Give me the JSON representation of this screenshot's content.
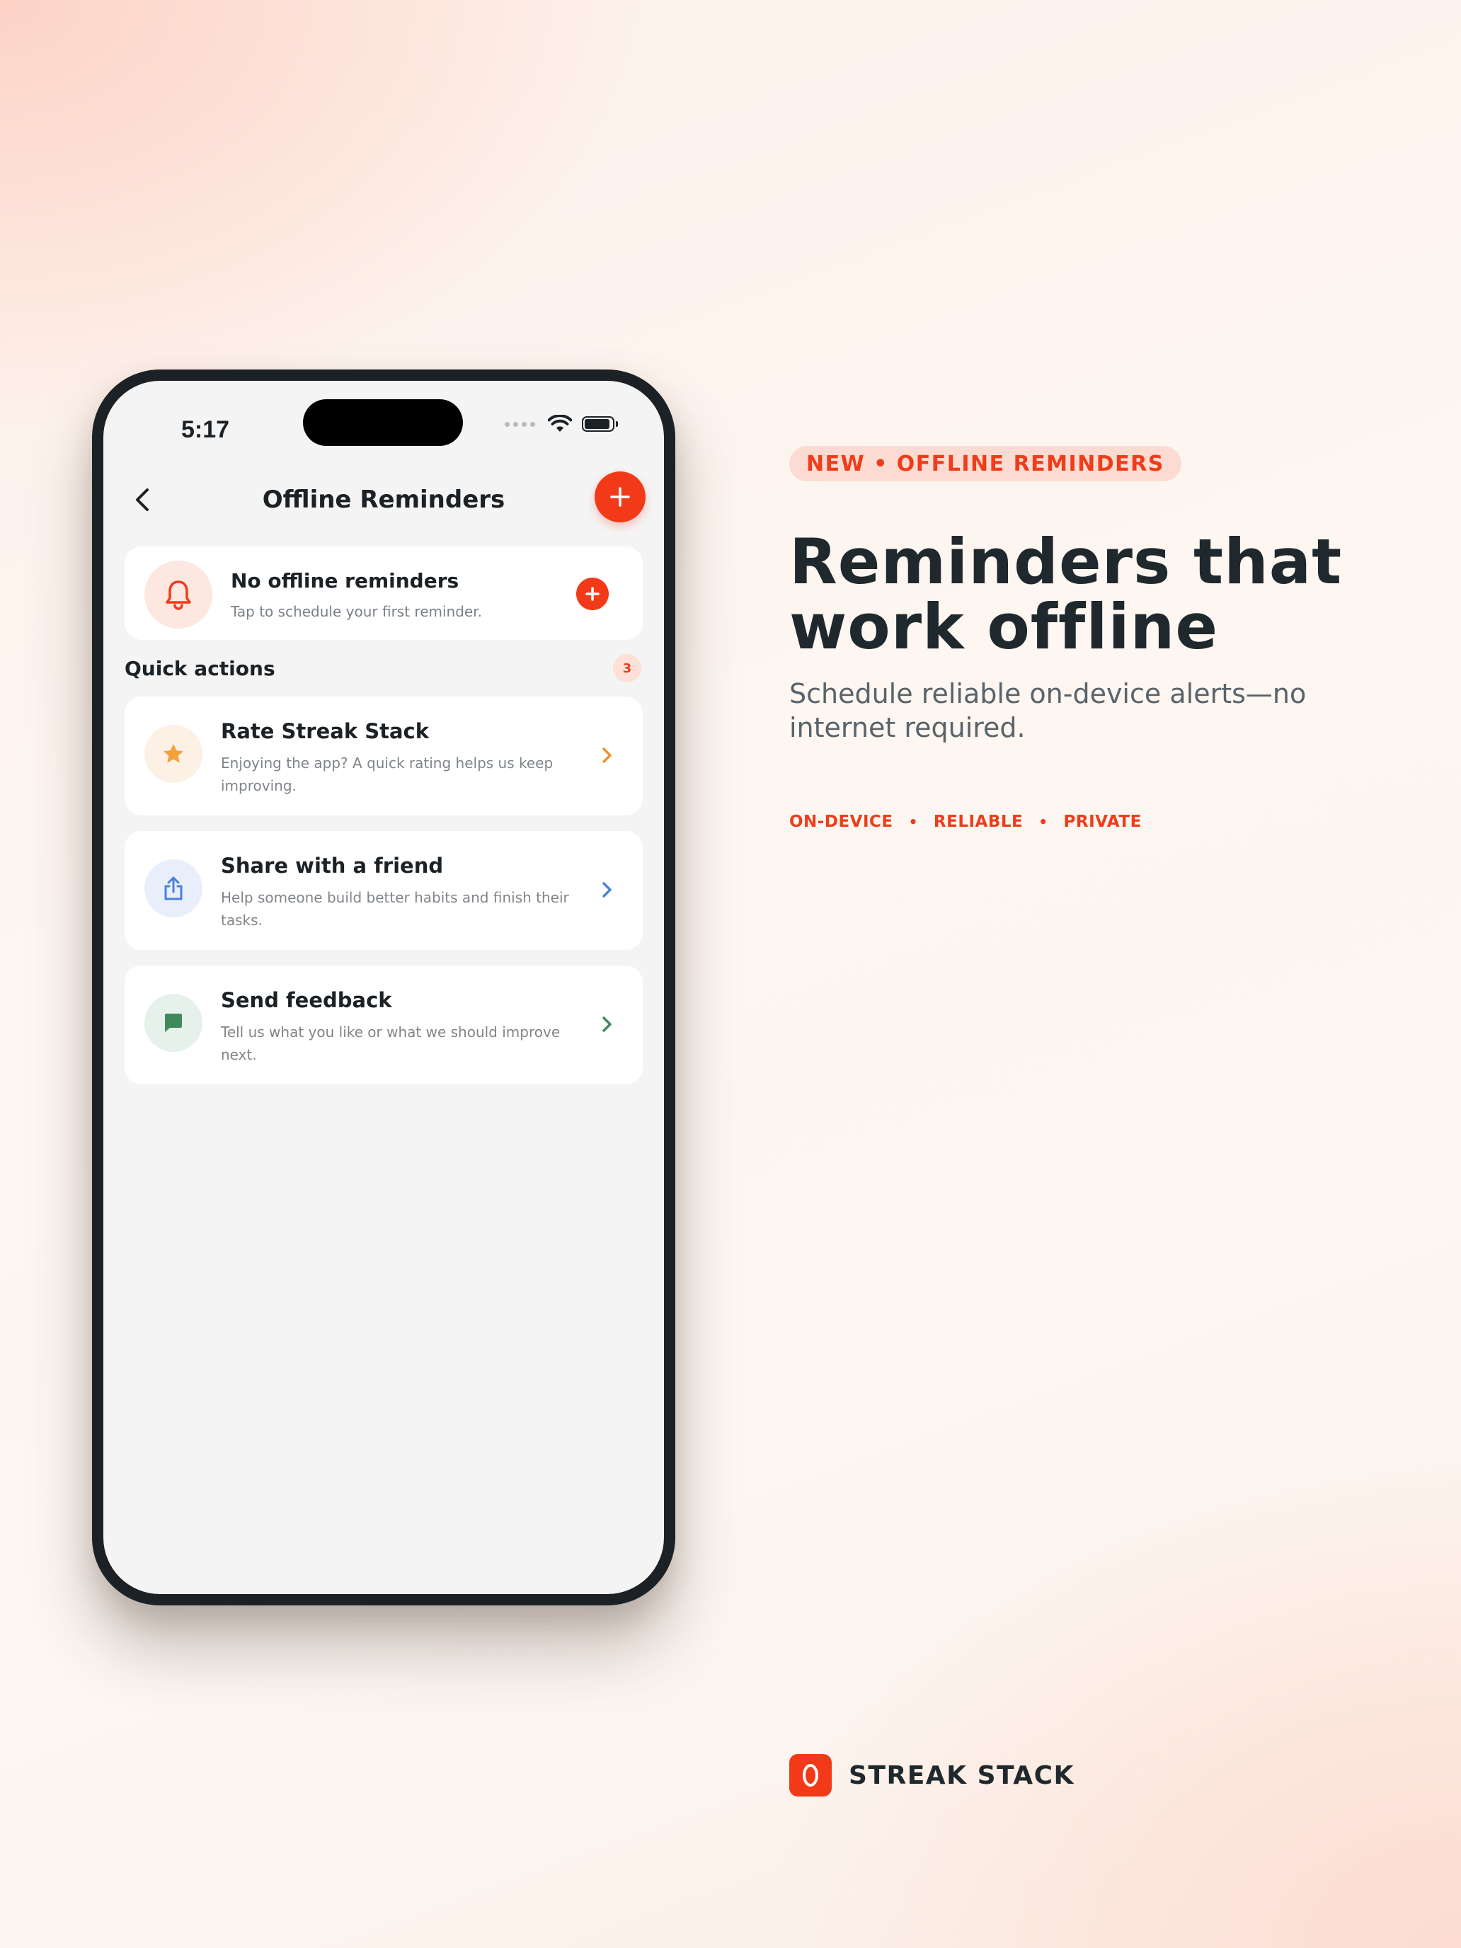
{
  "status_bar": {
    "time": "5:17"
  },
  "nav": {
    "title": "Offline Reminders"
  },
  "empty_state": {
    "title": "No offline reminders",
    "subtitle": "Tap to schedule your first reminder."
  },
  "quick_actions": {
    "heading": "Quick actions",
    "count": "3",
    "items": [
      {
        "title": "Rate Streak Stack",
        "description": "Enjoying the app? A quick rating helps us keep improving.",
        "icon": "star-icon",
        "icon_color": "#f3a13b",
        "icon_bg": "#fdf0e4",
        "chevron_color": "#f0922b"
      },
      {
        "title": "Share with a friend",
        "description": "Help someone build better habits and finish their tasks.",
        "icon": "share-icon",
        "icon_color": "#4b82d8",
        "icon_bg": "#e8effb",
        "chevron_color": "#4b82d8"
      },
      {
        "title": "Send feedback",
        "description": "Tell us what you like or what we should improve next.",
        "icon": "chat-icon",
        "icon_color": "#3f8a5c",
        "icon_bg": "#e5f1ea",
        "chevron_color": "#3f8a5c"
      }
    ]
  },
  "promo": {
    "pill": "NEW • OFFLINE REMINDERS",
    "headline_line1": "Reminders that",
    "headline_line2": "work offline",
    "subhead": "Schedule reliable on-device alerts—no internet required.",
    "tags": [
      "ON-DEVICE",
      "RELIABLE",
      "PRIVATE"
    ],
    "tag_separator": "•"
  },
  "brand": {
    "name": "STREAK STACK",
    "accent": "#f23a19"
  },
  "colors": {
    "accent": "#f23a19",
    "text_dark": "#1f292d",
    "screen_bg": "#f4f4f4"
  }
}
